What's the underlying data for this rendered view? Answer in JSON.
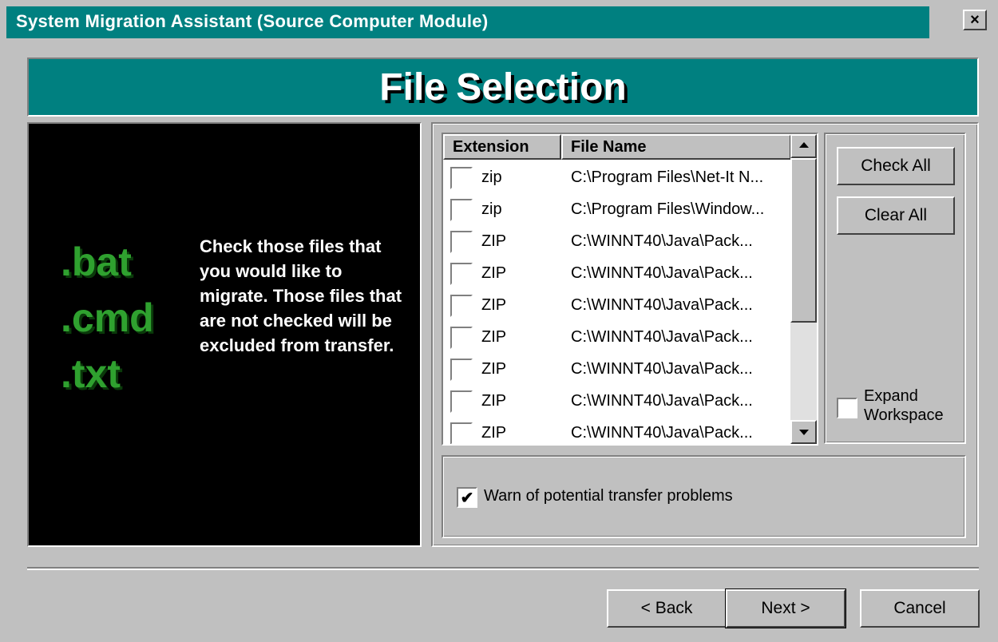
{
  "window": {
    "title": "System Migration Assistant (Source Computer Module)",
    "close_glyph": "×"
  },
  "header": {
    "title": "File Selection"
  },
  "info_panel": {
    "extensions": [
      ".bat",
      ".cmd",
      ".txt"
    ],
    "instruction": "Check those files that you would like to migrate.  Those files that are not checked will be excluded from transfer."
  },
  "file_list": {
    "columns": {
      "extension": "Extension",
      "file_name": "File Name"
    },
    "rows": [
      {
        "ext": "zip",
        "name": "C:\\Program Files\\Net-It N...",
        "checked": false
      },
      {
        "ext": "zip",
        "name": "C:\\Program Files\\Window...",
        "checked": false
      },
      {
        "ext": "ZIP",
        "name": "C:\\WINNT40\\Java\\Pack...",
        "checked": false
      },
      {
        "ext": "ZIP",
        "name": "C:\\WINNT40\\Java\\Pack...",
        "checked": false
      },
      {
        "ext": "ZIP",
        "name": "C:\\WINNT40\\Java\\Pack...",
        "checked": false
      },
      {
        "ext": "ZIP",
        "name": "C:\\WINNT40\\Java\\Pack...",
        "checked": false
      },
      {
        "ext": "ZIP",
        "name": "C:\\WINNT40\\Java\\Pack...",
        "checked": false
      },
      {
        "ext": "ZIP",
        "name": "C:\\WINNT40\\Java\\Pack...",
        "checked": false
      },
      {
        "ext": "ZIP",
        "name": "C:\\WINNT40\\Java\\Pack...",
        "checked": false
      }
    ]
  },
  "side_buttons": {
    "check_all": "Check All",
    "clear_all": "Clear All",
    "expand_workspace_line1": "Expand",
    "expand_workspace_line2": "Workspace",
    "expand_workspace_checked": false
  },
  "options": {
    "warn_label": "Warn of potential transfer problems",
    "warn_checked": true,
    "check_glyph": "✔"
  },
  "nav_buttons": {
    "back": "< Back",
    "next": "Next >",
    "cancel": "Cancel"
  },
  "colors": {
    "title_bar": "#008080",
    "banner": "#008080",
    "face": "#c0c0c0",
    "extension_green": "#2fa12f"
  }
}
